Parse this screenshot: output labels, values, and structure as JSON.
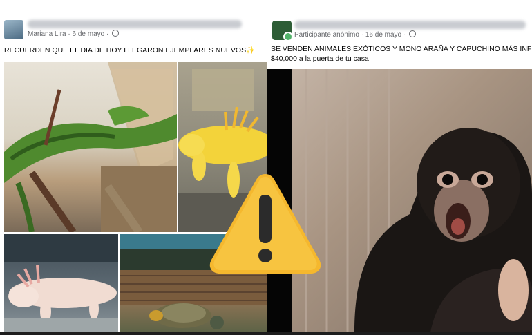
{
  "posts": [
    {
      "author": "Mariana Lira",
      "date": "6 de mayo",
      "separator": "·",
      "caption": "RECUERDEN QUE EL DIA DE HOY LLEGARON EJEMPLARES NUEVOS✨"
    },
    {
      "author": "Participante anónimo",
      "date": "16 de mayo",
      "separator": "·",
      "caption": "SE VENDEN ANIMALES EXÓTICOS Y MONO ARAÑA Y CAPUCHINO MÁS INF $40,000 a la puerta de tu casa"
    }
  ],
  "photos": [
    "iguana",
    "axolotl-yellow",
    "axolotl-pink",
    "turtle",
    "spider-monkey"
  ],
  "icons": {
    "warning": "warning-triangle-icon",
    "privacy": "globe-icon"
  },
  "colors": {
    "warning_fill": "#f5b82e",
    "warning_mark": "#2b2b2b",
    "meta_text": "#65676b",
    "caption_text": "#050505"
  }
}
